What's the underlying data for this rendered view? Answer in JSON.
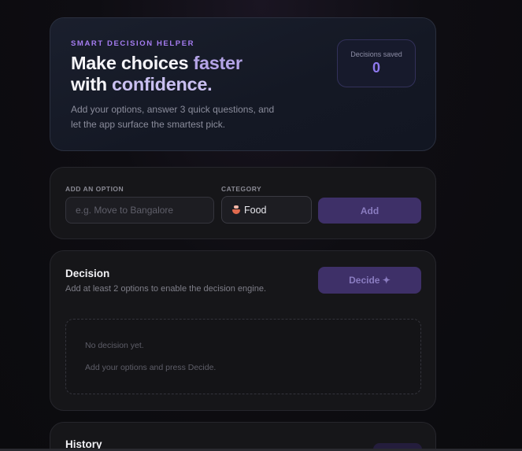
{
  "hero": {
    "eyebrow": "SMART DECISION HELPER",
    "headline_part1": "Make choices ",
    "headline_accent": "faster",
    "headline_part2": "with ",
    "headline_accent2": "confidence.",
    "subtext": "Add your options, answer 3 quick questions, and let the app surface the smartest pick.",
    "saved_label": "Decisions saved",
    "saved_count": "0"
  },
  "add_option": {
    "option_label": "ADD AN OPTION",
    "option_placeholder": "e.g. Move to Bangalore",
    "option_value": "",
    "category_label": "CATEGORY",
    "category_selected": "Food",
    "category_icon": "food-icon",
    "add_button": "Add"
  },
  "decision": {
    "title": "Decision",
    "description": "Add at least 2 options to enable the decision engine.",
    "decide_button": "Decide ✦",
    "empty_line1": "No decision yet.",
    "empty_line2": "Add your options and press Decide."
  },
  "history": {
    "title": "History"
  },
  "colors": {
    "accent": "#8e79ee",
    "eyebrow": "#a47cf0",
    "button_bg": "#3e3068"
  }
}
